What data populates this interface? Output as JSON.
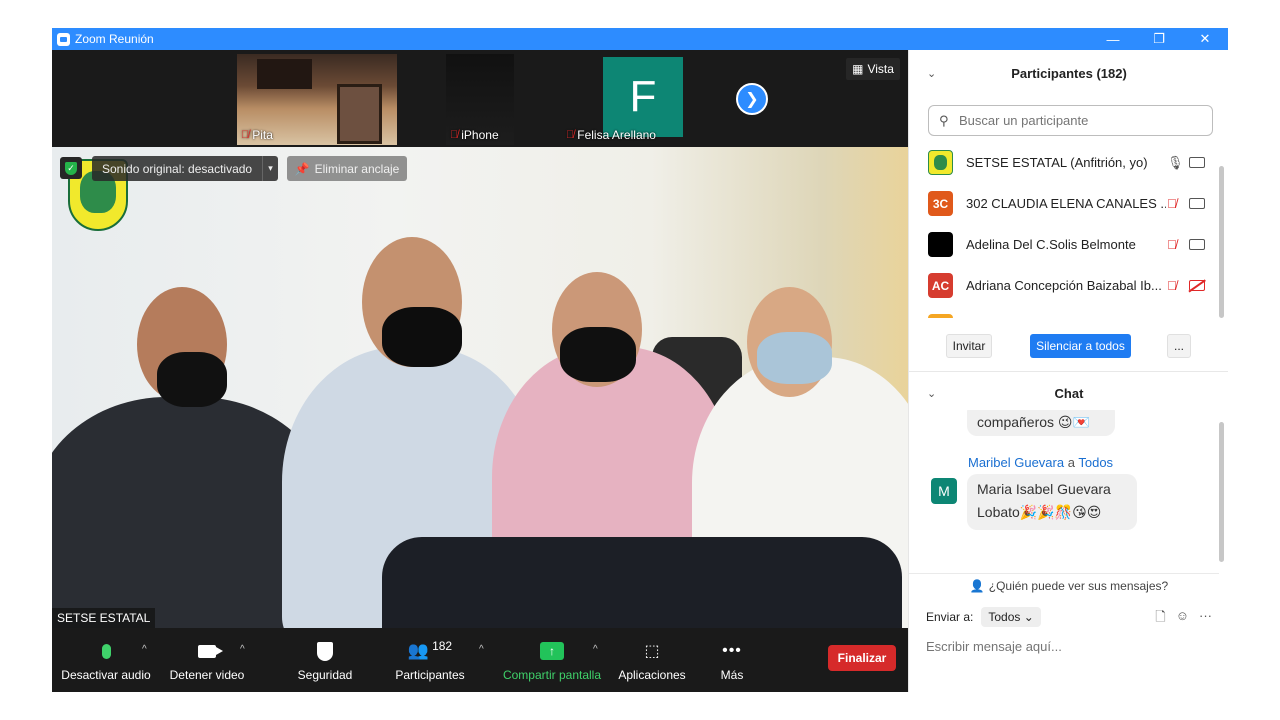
{
  "window": {
    "title": "Zoom Reunión",
    "minimize_glyph": "—",
    "restore_glyph": "❐",
    "close_glyph": "✕"
  },
  "strip": {
    "thumbs": [
      {
        "name": "Pita"
      },
      {
        "name": "iPhone"
      },
      {
        "name": "Felisa Arellano",
        "initial": "F"
      }
    ],
    "vista_label": "Vista"
  },
  "main": {
    "sonido_label": "Sonido original: desactivado",
    "eliminar_label": "Eliminar anclaje",
    "speaker_name": "SETSE ESTATAL"
  },
  "toolbar": {
    "audio_label": "Desactivar audio",
    "video_label": "Detener video",
    "security_label": "Seguridad",
    "participants_label": "Participantes",
    "participants_count": "182",
    "share_label": "Compartir pantalla",
    "apps_label": "Aplicaciones",
    "more_label": "Más",
    "end_label": "Finalizar"
  },
  "participants_panel": {
    "title": "Participantes (182)",
    "search_placeholder": "Buscar un participante",
    "rows": [
      {
        "initials": "",
        "name": "SETSE ESTATAL (Anfitrión, yo)",
        "avatar_color": "#f1e92c",
        "mic": "on",
        "cam": "on"
      },
      {
        "initials": "3C",
        "name": "302 CLAUDIA ELENA CANALES ...",
        "avatar_color": "#e0591b",
        "mic": "off",
        "cam": "on"
      },
      {
        "initials": "",
        "name": "Adelina Del C.Solis Belmonte",
        "avatar_color": "#000000",
        "mic": "off",
        "cam": "on"
      },
      {
        "initials": "AC",
        "name": "Adriana Concepción Baizabal Ib...",
        "avatar_color": "#d63c2f",
        "mic": "off",
        "cam": "off"
      }
    ],
    "invite_label": "Invitar",
    "mute_all_label": "Silenciar a todos",
    "more_label": "..."
  },
  "chat": {
    "title": "Chat",
    "prev_message": "compañeros 😉💌",
    "sender": "Maribel Guevara",
    "to_word": "a",
    "recipient": "Todos",
    "avatar_initial": "M",
    "message": "Maria Isabel Guevara Lobato🎉🎉🎊😘😍",
    "who_sees": "¿Quién puede ver sus mensajes?",
    "send_to_label": "Enviar a:",
    "send_to_value": "Todos",
    "input_placeholder": "Escribir mensaje aquí..."
  },
  "colors": {
    "titlebar": "#2d8cff",
    "accent_green": "#3fd16a",
    "end_red": "#d62a2a",
    "primary_blue": "#1f7cf2"
  }
}
